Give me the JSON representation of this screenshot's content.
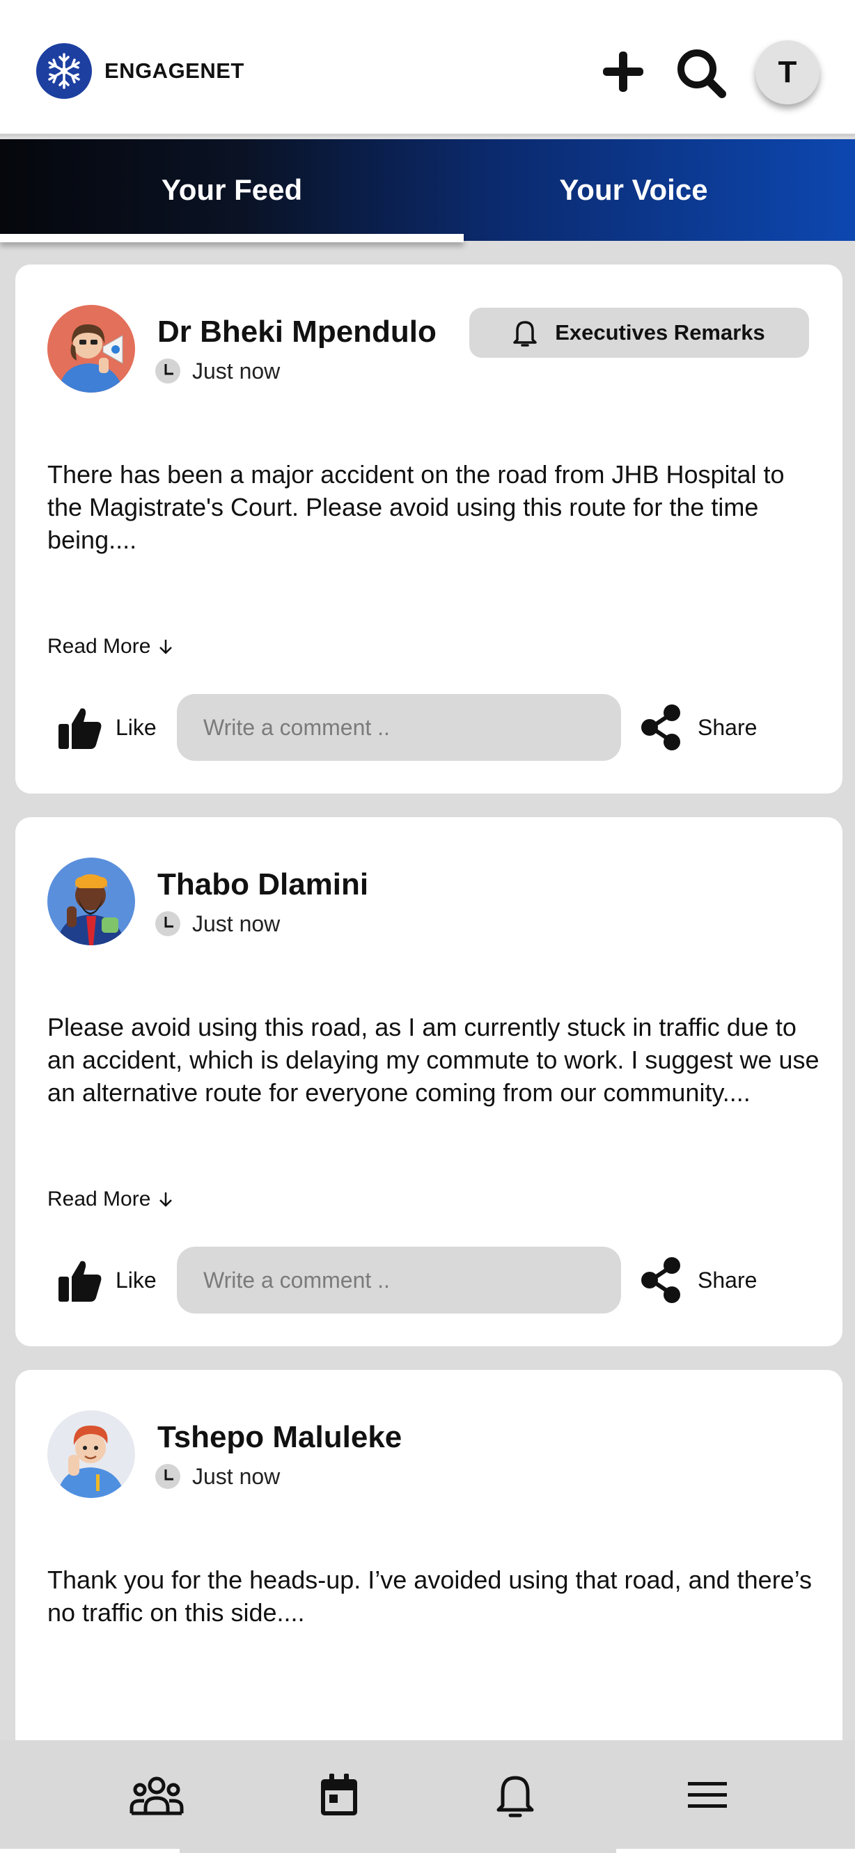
{
  "app": {
    "brand": "ENGAGENET",
    "user_initial": "T"
  },
  "header": {
    "icons": [
      "snowflake-logo-icon",
      "plus-icon",
      "search-icon"
    ]
  },
  "tabs": [
    {
      "label": "Your Feed",
      "active": true
    },
    {
      "label": "Your Voice",
      "active": false
    }
  ],
  "posts": [
    {
      "author": "Dr Bheki Mpendulo",
      "time": "Just now",
      "badge": "Executives Remarks",
      "text": "There has been a major accident on the road from JHB Hospital to the Magistrate's Court. Please avoid using this route for the time being....",
      "read_more": "Read More",
      "like_label": "Like",
      "comment_placeholder": "Write a comment ..",
      "share_label": "Share"
    },
    {
      "author": "Thabo Dlamini",
      "time": "Just now",
      "text": "Please avoid using this road, as I am currently stuck in traffic due to an accident, which is delaying my commute to work. I suggest we use an alternative route for everyone coming from our community....",
      "read_more": "Read More",
      "like_label": "Like",
      "comment_placeholder": "Write a comment ..",
      "share_label": "Share"
    },
    {
      "author": "Tshepo Maluleke",
      "time": "Just now",
      "text": "Thank you for the heads-up. I’ve avoided using that road, and there’s no traffic on this side...."
    }
  ],
  "bottom_nav": {
    "icons": [
      "community-icon",
      "calendar-icon",
      "bell-icon",
      "menu-icon"
    ]
  },
  "colors": {
    "brand_blue": "#1d3fa0",
    "tab_gradient_end": "#0d47b0",
    "background": "#dcdcdc"
  }
}
